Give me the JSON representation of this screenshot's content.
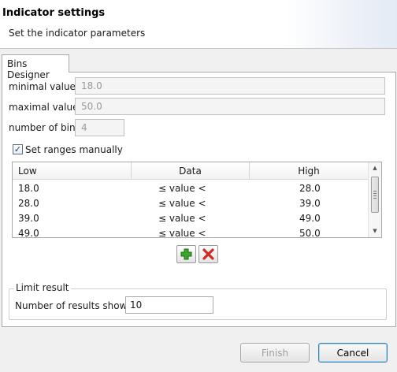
{
  "header": {
    "title": "Indicator settings",
    "subtitle": "Set the indicator parameters"
  },
  "tabs": [
    {
      "label": "Bins Designer",
      "active": true
    }
  ],
  "fields": {
    "minimal_value": {
      "label": "minimal value",
      "value": "18.0"
    },
    "maximal_value": {
      "label": "maximal value",
      "value": "50.0"
    },
    "number_of_bins": {
      "label": "number of bins",
      "value": "4"
    }
  },
  "set_ranges": {
    "label": "Set ranges manually",
    "checked": true,
    "check_glyph": "✓"
  },
  "grid": {
    "columns": [
      "Low",
      "Data",
      "High"
    ],
    "rows": [
      {
        "low": "18.0",
        "data": "≤ value <",
        "high": "28.0"
      },
      {
        "low": "28.0",
        "data": "≤ value <",
        "high": "39.0"
      },
      {
        "low": "39.0",
        "data": "≤ value <",
        "high": "49.0"
      },
      {
        "low": "49.0",
        "data": "≤ value <",
        "high": "50.0"
      }
    ]
  },
  "actions": {
    "add_icon": "plus-icon",
    "remove_icon": "delete-icon",
    "add_color": "#3aa62a",
    "remove_color": "#d12a1f"
  },
  "limit": {
    "group_title": "Limit result",
    "label": "Number of results shown:",
    "value": "10"
  },
  "footer": {
    "finish_label": "Finish",
    "cancel_label": "Cancel"
  }
}
